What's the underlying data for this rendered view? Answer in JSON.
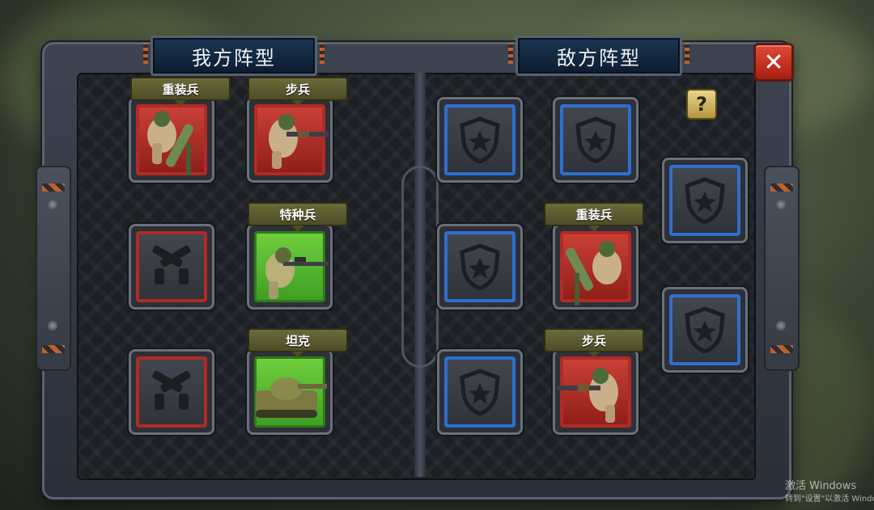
{
  "panels": {
    "ally_title": "我方阵型",
    "enemy_title": "敌方阵型"
  },
  "buttons": {
    "close_symbol": "✕",
    "help_symbol": "?"
  },
  "ally_units": {
    "heavy": "重装兵",
    "infantry": "步兵",
    "special": "特种兵",
    "tank": "坦克"
  },
  "enemy_units": {
    "heavy": "重装兵",
    "infantry": "步兵"
  },
  "colors": {
    "ally_empty_border": "#b22a24",
    "enemy_empty_border": "#2f6fcf",
    "selected_slot": "#6fcf3c",
    "close_button": "#d8382a"
  },
  "watermark": {
    "line1": "激活 Windows",
    "line2": "转到\"设置\"以激活 Windo"
  }
}
